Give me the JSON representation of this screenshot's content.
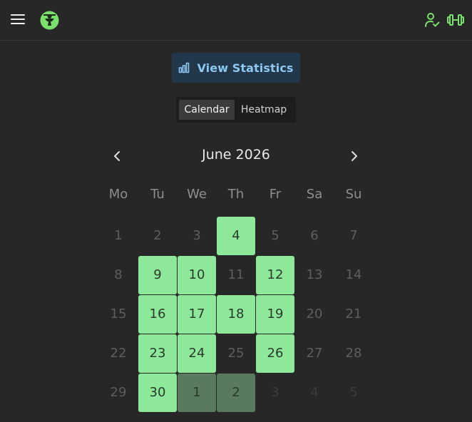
{
  "header": {
    "menu_icon": "hamburger-menu-icon",
    "logo_icon": "app-logo-icon",
    "profile_icon": "profile-check-icon",
    "dumbbell_icon": "dumbbell-icon",
    "accent_color": "#7be16d"
  },
  "stats_button": {
    "label": "View Statistics",
    "icon": "bar-chart-icon"
  },
  "view_toggle": {
    "options": [
      "Calendar",
      "Heatmap"
    ],
    "selected": "Calendar"
  },
  "calendar": {
    "month_label": "June 2026",
    "weekdays": [
      "Mo",
      "Tu",
      "We",
      "Th",
      "Fr",
      "Sa",
      "Su"
    ],
    "active_color": "#8ee89a",
    "weeks": [
      [
        {
          "day": "1",
          "state": "dim"
        },
        {
          "day": "2",
          "state": "dim"
        },
        {
          "day": "3",
          "state": "dim"
        },
        {
          "day": "4",
          "state": "active"
        },
        {
          "day": "5",
          "state": "dim"
        },
        {
          "day": "6",
          "state": "dim"
        },
        {
          "day": "7",
          "state": "dim"
        }
      ],
      [
        {
          "day": "8",
          "state": "dim"
        },
        {
          "day": "9",
          "state": "active"
        },
        {
          "day": "10",
          "state": "active"
        },
        {
          "day": "11",
          "state": "dim"
        },
        {
          "day": "12",
          "state": "active"
        },
        {
          "day": "13",
          "state": "dim"
        },
        {
          "day": "14",
          "state": "dim"
        }
      ],
      [
        {
          "day": "15",
          "state": "dim"
        },
        {
          "day": "16",
          "state": "active"
        },
        {
          "day": "17",
          "state": "active"
        },
        {
          "day": "18",
          "state": "active"
        },
        {
          "day": "19",
          "state": "active"
        },
        {
          "day": "20",
          "state": "dim"
        },
        {
          "day": "21",
          "state": "dim"
        }
      ],
      [
        {
          "day": "22",
          "state": "dim"
        },
        {
          "day": "23",
          "state": "active"
        },
        {
          "day": "24",
          "state": "active"
        },
        {
          "day": "25",
          "state": "dim"
        },
        {
          "day": "26",
          "state": "active"
        },
        {
          "day": "27",
          "state": "dim"
        },
        {
          "day": "28",
          "state": "dim"
        }
      ],
      [
        {
          "day": "29",
          "state": "dim"
        },
        {
          "day": "30",
          "state": "active"
        },
        {
          "day": "1",
          "state": "next-active"
        },
        {
          "day": "2",
          "state": "next-active"
        },
        {
          "day": "3",
          "state": "next-dim"
        },
        {
          "day": "4",
          "state": "next-dim"
        },
        {
          "day": "5",
          "state": "next-dim"
        }
      ]
    ]
  }
}
